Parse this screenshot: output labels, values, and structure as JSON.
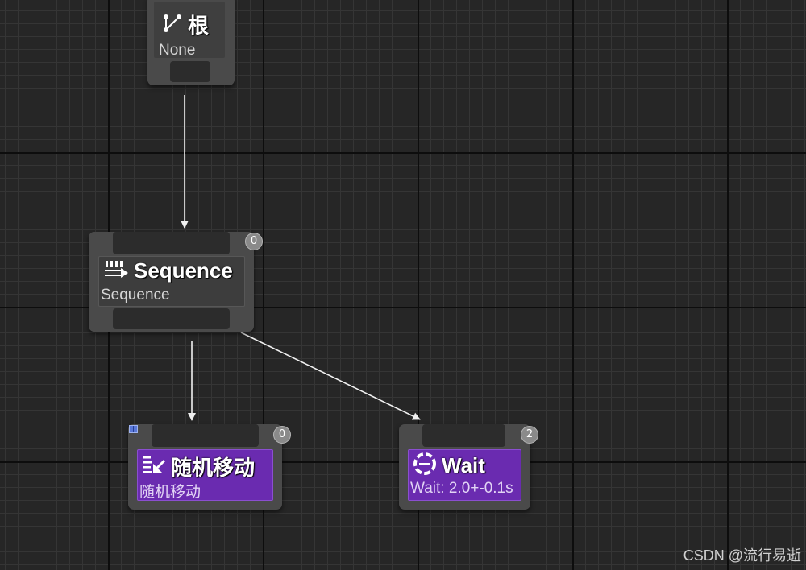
{
  "graph": {
    "root_node": {
      "icon": "root-branch-icon",
      "title": "根",
      "subtitle": "None"
    },
    "sequence_node": {
      "icon": "sequence-icon",
      "title": "Sequence",
      "subtitle": "Sequence",
      "index": "0"
    },
    "random_move_node": {
      "icon": "task-icon",
      "title": "随机移动",
      "subtitle": "随机移动",
      "index": "0"
    },
    "wait_node": {
      "icon": "wait-icon",
      "title": "Wait",
      "subtitle": "Wait: 2.0+-0.1s",
      "index": "2"
    }
  },
  "colors": {
    "background": "#262626",
    "node_gray": "#4a4a4a",
    "task_purple": "#6a2bb0",
    "badge": "#8a8a8a"
  },
  "watermark": "CSDN @流行易逝"
}
